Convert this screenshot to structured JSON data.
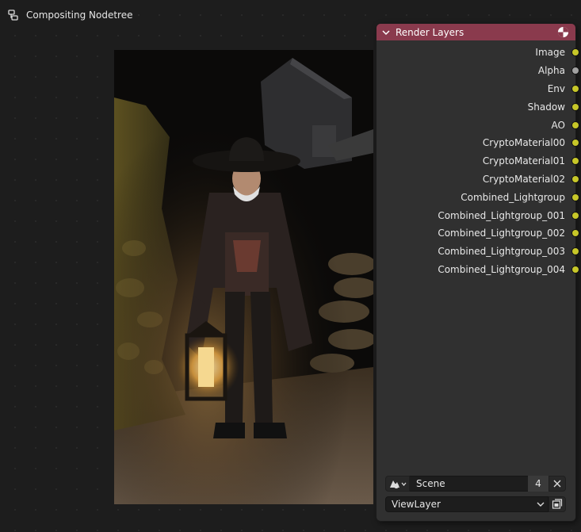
{
  "editor": {
    "title": "Compositing Nodetree",
    "icon": "node-tree-icon"
  },
  "node": {
    "title": "Render Layers",
    "header_color": "#8a3a4d",
    "collapse_icon": "chevron-down-icon",
    "type_icon": "render-result-icon",
    "outputs": [
      {
        "label": "Image",
        "socket_color": "#c7c729"
      },
      {
        "label": "Alpha",
        "socket_color": "#a1a1a1"
      },
      {
        "label": "Env",
        "socket_color": "#c7c729"
      },
      {
        "label": "Shadow",
        "socket_color": "#c7c729"
      },
      {
        "label": "AO",
        "socket_color": "#c7c729"
      },
      {
        "label": "CryptoMaterial00",
        "socket_color": "#c7c729"
      },
      {
        "label": "CryptoMaterial01",
        "socket_color": "#c7c729"
      },
      {
        "label": "CryptoMaterial02",
        "socket_color": "#c7c729"
      },
      {
        "label": "Combined_Lightgroup",
        "socket_color": "#c7c729"
      },
      {
        "label": "Combined_Lightgroup_001",
        "socket_color": "#c7c729"
      },
      {
        "label": "Combined_Lightgroup_002",
        "socket_color": "#c7c729"
      },
      {
        "label": "Combined_Lightgroup_003",
        "socket_color": "#c7c729"
      },
      {
        "label": "Combined_Lightgroup_004",
        "socket_color": "#c7c729"
      }
    ],
    "scene": {
      "name": "Scene",
      "users": "4",
      "browse_icon": "scene-browse-icon",
      "unlink_icon": "close-icon"
    },
    "view_layer": {
      "name": "ViewLayer",
      "dropdown_icon": "chevron-down-icon",
      "action_icon": "render-layer-icon"
    }
  },
  "backdrop": {
    "description_icon": "backdrop-render-image"
  }
}
